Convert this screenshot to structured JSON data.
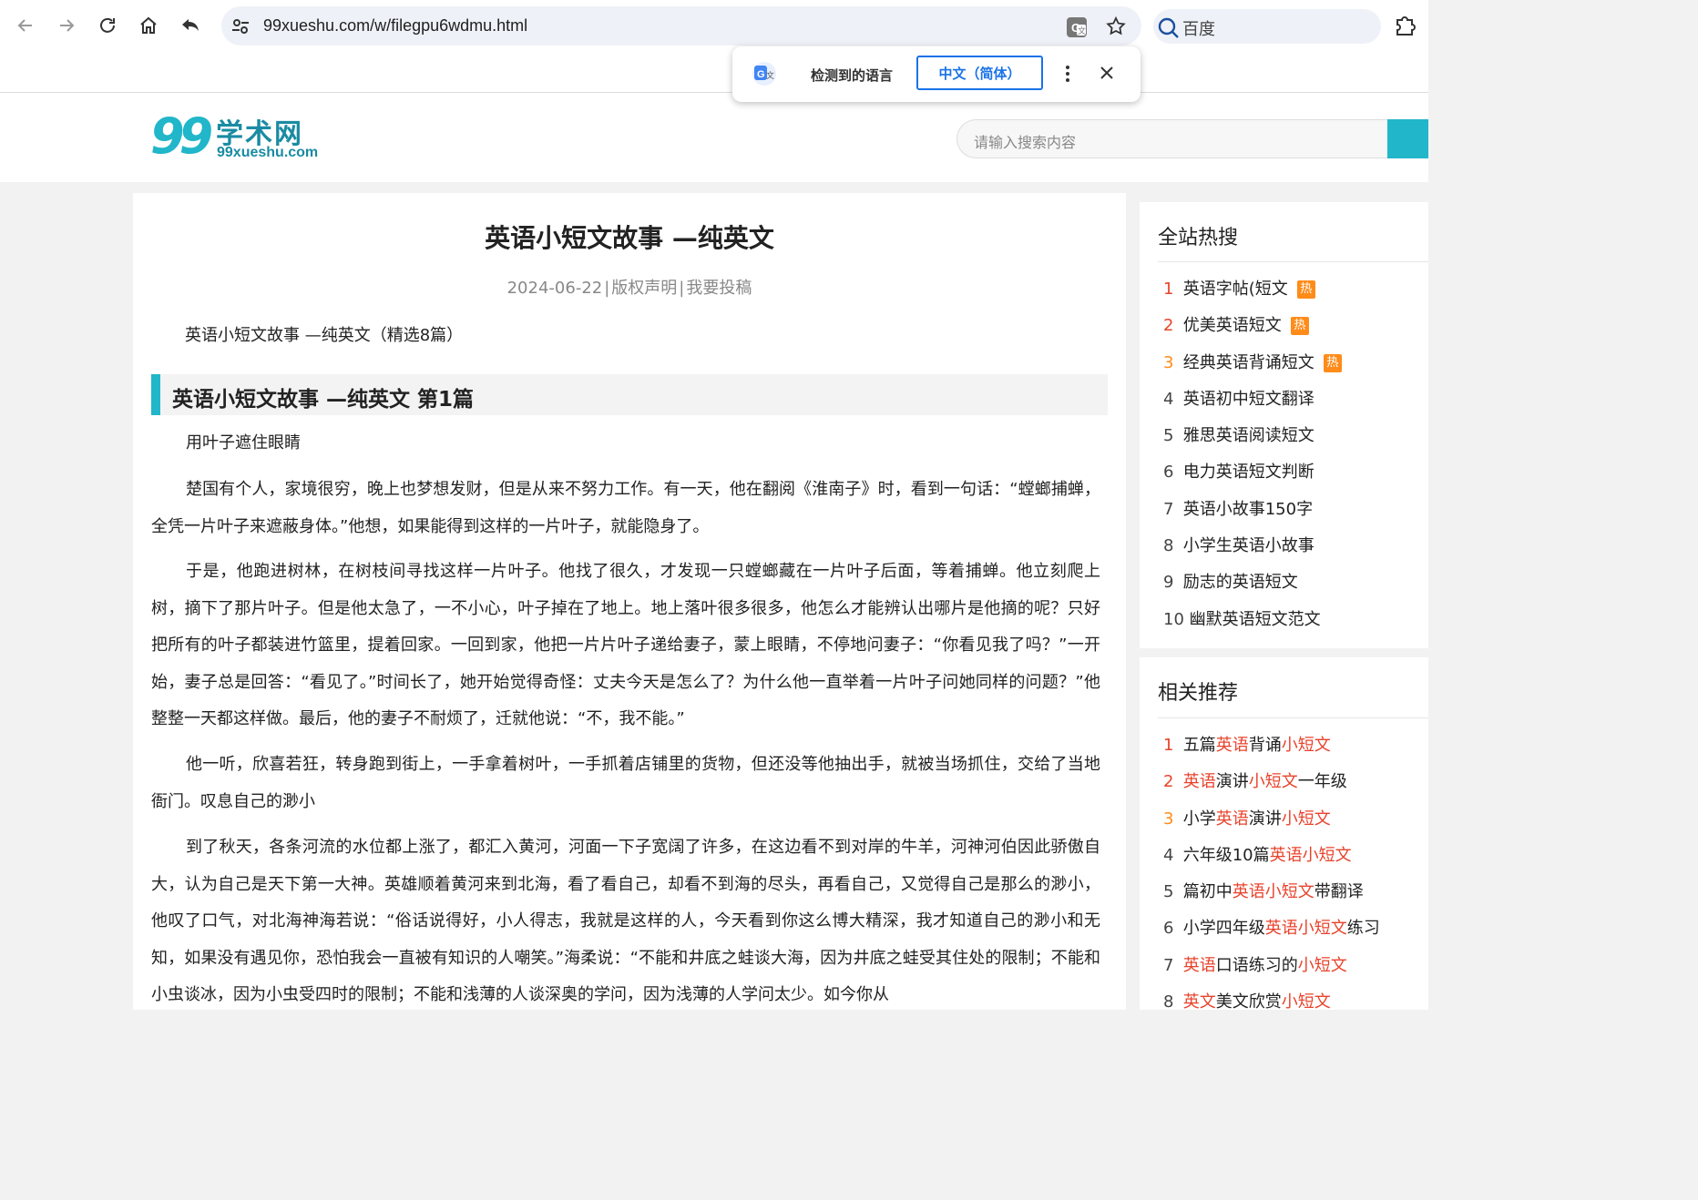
{
  "browser": {
    "url": "99xueshu.com/w/filegpu6wdmu.html",
    "search_engine": "百度"
  },
  "translate_popup": {
    "detected_label": "检测到的语言",
    "target_language": "中文（简体）"
  },
  "site": {
    "logo_number": "99",
    "logo_name": "学术网",
    "logo_domain": "99xueshu.com",
    "search_placeholder": "请输入搜索内容",
    "accent_color": "#21b6c9"
  },
  "article": {
    "title": "英语小短文故事 —纯英文",
    "date": "2024-06-22",
    "sep": "|",
    "copyright_link": "版权声明",
    "submit_link": "我要投稿",
    "intro": "英语小短文故事 —纯英文（精选8篇）",
    "section_heading": "英语小短文故事 —纯英文 第1篇",
    "paragraphs": [
      "用叶子遮住眼睛",
      "楚国有个人，家境很穷，晚上也梦想发财，但是从来不努力工作。有一天，他在翻阅《淮南子》时，看到一句话：“螳螂捕蝉，全凭一片叶子来遮蔽身体。”他想，如果能得到这样的一片叶子，就能隐身了。",
      "于是，他跑进树林，在树枝间寻找这样一片叶子。他找了很久，才发现一只螳螂藏在一片叶子后面，等着捕蝉。他立刻爬上树，摘下了那片叶子。但是他太急了，一不小心，叶子掉在了地上。地上落叶很多很多，他怎么才能辨认出哪片是他摘的呢？只好把所有的叶子都装进竹篮里，提着回家。一回到家，他把一片片叶子递给妻子，蒙上眼睛，不停地问妻子：“你看见我了吗？”一开始，妻子总是回答：“看见了。”时间长了，她开始觉得奇怪：丈夫今天是怎么了？为什么他一直举着一片叶子问她同样的问题？”他整整一天都这样做。最后，他的妻子不耐烦了，迁就他说：“不，我不能。”",
      "他一听，欣喜若狂，转身跑到街上，一手拿着树叶，一手抓着店铺里的货物，但还没等他抽出手，就被当场抓住，交给了当地衙门。叹息自己的渺小",
      "到了秋天，各条河流的水位都上涨了，都汇入黄河，河面一下子宽阔了许多，在这边看不到对岸的牛羊，河神河伯因此骄傲自大，认为自己是天下第一大神。英雄顺着黄河来到北海，看了看自己，却看不到海的尽头，再看自己，又觉得自己是那么的渺小，他叹了口气，对北海神海若说：“俗话说得好，小人得志，我就是这样的人，今天看到你这么博大精深，我才知道自己的渺小和无知，如果没有遇见你，恐怕我会一直被有知识的人嘲笑。”海柔说：“不能和井底之蛙谈大海，因为井底之蛙受其住处的限制；不能和小虫谈冰，因为小虫受四时的限制；不能和浅薄的人谈深奥的学问，因为浅薄的人学问太少。如今你从"
    ]
  },
  "sidebar": {
    "hot_title": "全站热搜",
    "hot_badge": "热",
    "hot_items": [
      {
        "n": "1",
        "text": "英语字帖(短文",
        "hot": true
      },
      {
        "n": "2",
        "text": "优美英语短文",
        "hot": true
      },
      {
        "n": "3",
        "text": "经典英语背诵短文",
        "hot": true
      },
      {
        "n": "4",
        "text": "英语初中短文翻译",
        "hot": false
      },
      {
        "n": "5",
        "text": "雅思英语阅读短文",
        "hot": false
      },
      {
        "n": "6",
        "text": "电力英语短文判断",
        "hot": false
      },
      {
        "n": "7",
        "text": "英语小故事150字",
        "hot": false
      },
      {
        "n": "8",
        "text": "小学生英语小故事",
        "hot": false
      },
      {
        "n": "9",
        "text": "励志的英语短文",
        "hot": false
      },
      {
        "n": "10",
        "text": "幽默英语短文范文",
        "hot": false
      }
    ],
    "rec_title": "相关推荐",
    "rec_items": [
      {
        "n": "1",
        "parts": [
          [
            "五篇",
            false
          ],
          [
            "英语",
            true
          ],
          [
            "背诵",
            false
          ],
          [
            "小短文",
            true
          ]
        ]
      },
      {
        "n": "2",
        "parts": [
          [
            "英语",
            true
          ],
          [
            "演讲",
            false
          ],
          [
            "小短文",
            true
          ],
          [
            "一年级",
            false
          ]
        ]
      },
      {
        "n": "3",
        "parts": [
          [
            "小学",
            false
          ],
          [
            "英语",
            true
          ],
          [
            "演讲",
            false
          ],
          [
            "小短文",
            true
          ]
        ]
      },
      {
        "n": "4",
        "parts": [
          [
            "六年级10篇",
            false
          ],
          [
            "英语小短文",
            true
          ]
        ]
      },
      {
        "n": "5",
        "parts": [
          [
            "篇初中",
            false
          ],
          [
            "英语小短文",
            true
          ],
          [
            "带翻译",
            false
          ]
        ]
      },
      {
        "n": "6",
        "parts": [
          [
            "小学四年级",
            false
          ],
          [
            "英语小短文",
            true
          ],
          [
            "练习",
            false
          ]
        ]
      },
      {
        "n": "7",
        "parts": [
          [
            "英语",
            true
          ],
          [
            "口语练习的",
            false
          ],
          [
            "小短文",
            true
          ]
        ]
      },
      {
        "n": "8",
        "parts": [
          [
            "英文",
            true
          ],
          [
            "美文欣赏",
            false
          ],
          [
            "小短文",
            true
          ]
        ]
      }
    ]
  }
}
